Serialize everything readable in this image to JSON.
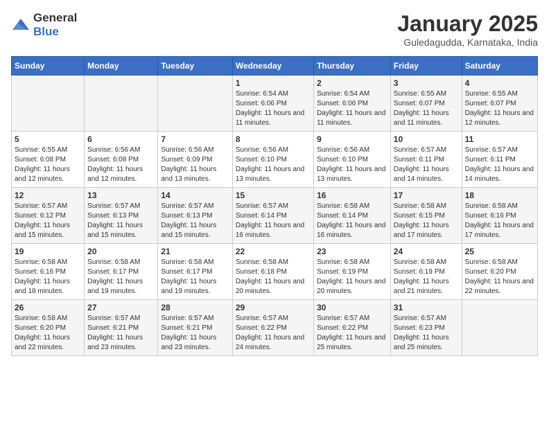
{
  "logo": {
    "general": "General",
    "blue": "Blue"
  },
  "header": {
    "title": "January 2025",
    "subtitle": "Guledagudda, Karnataka, India"
  },
  "weekdays": [
    "Sunday",
    "Monday",
    "Tuesday",
    "Wednesday",
    "Thursday",
    "Friday",
    "Saturday"
  ],
  "weeks": [
    [
      {
        "day": "",
        "info": ""
      },
      {
        "day": "",
        "info": ""
      },
      {
        "day": "",
        "info": ""
      },
      {
        "day": "1",
        "info": "Sunrise: 6:54 AM\nSunset: 6:06 PM\nDaylight: 11 hours and 11 minutes."
      },
      {
        "day": "2",
        "info": "Sunrise: 6:54 AM\nSunset: 6:06 PM\nDaylight: 11 hours and 11 minutes."
      },
      {
        "day": "3",
        "info": "Sunrise: 6:55 AM\nSunset: 6:07 PM\nDaylight: 11 hours and 11 minutes."
      },
      {
        "day": "4",
        "info": "Sunrise: 6:55 AM\nSunset: 6:07 PM\nDaylight: 11 hours and 12 minutes."
      }
    ],
    [
      {
        "day": "5",
        "info": "Sunrise: 6:55 AM\nSunset: 6:08 PM\nDaylight: 11 hours and 12 minutes."
      },
      {
        "day": "6",
        "info": "Sunrise: 6:56 AM\nSunset: 6:08 PM\nDaylight: 11 hours and 12 minutes."
      },
      {
        "day": "7",
        "info": "Sunrise: 6:56 AM\nSunset: 6:09 PM\nDaylight: 11 hours and 13 minutes."
      },
      {
        "day": "8",
        "info": "Sunrise: 6:56 AM\nSunset: 6:10 PM\nDaylight: 11 hours and 13 minutes."
      },
      {
        "day": "9",
        "info": "Sunrise: 6:56 AM\nSunset: 6:10 PM\nDaylight: 11 hours and 13 minutes."
      },
      {
        "day": "10",
        "info": "Sunrise: 6:57 AM\nSunset: 6:11 PM\nDaylight: 11 hours and 14 minutes."
      },
      {
        "day": "11",
        "info": "Sunrise: 6:57 AM\nSunset: 6:11 PM\nDaylight: 11 hours and 14 minutes."
      }
    ],
    [
      {
        "day": "12",
        "info": "Sunrise: 6:57 AM\nSunset: 6:12 PM\nDaylight: 11 hours and 15 minutes."
      },
      {
        "day": "13",
        "info": "Sunrise: 6:57 AM\nSunset: 6:13 PM\nDaylight: 11 hours and 15 minutes."
      },
      {
        "day": "14",
        "info": "Sunrise: 6:57 AM\nSunset: 6:13 PM\nDaylight: 11 hours and 15 minutes."
      },
      {
        "day": "15",
        "info": "Sunrise: 6:57 AM\nSunset: 6:14 PM\nDaylight: 11 hours and 16 minutes."
      },
      {
        "day": "16",
        "info": "Sunrise: 6:58 AM\nSunset: 6:14 PM\nDaylight: 11 hours and 16 minutes."
      },
      {
        "day": "17",
        "info": "Sunrise: 6:58 AM\nSunset: 6:15 PM\nDaylight: 11 hours and 17 minutes."
      },
      {
        "day": "18",
        "info": "Sunrise: 6:58 AM\nSunset: 6:16 PM\nDaylight: 11 hours and 17 minutes."
      }
    ],
    [
      {
        "day": "19",
        "info": "Sunrise: 6:58 AM\nSunset: 6:16 PM\nDaylight: 11 hours and 18 minutes."
      },
      {
        "day": "20",
        "info": "Sunrise: 6:58 AM\nSunset: 6:17 PM\nDaylight: 11 hours and 19 minutes."
      },
      {
        "day": "21",
        "info": "Sunrise: 6:58 AM\nSunset: 6:17 PM\nDaylight: 11 hours and 19 minutes."
      },
      {
        "day": "22",
        "info": "Sunrise: 6:58 AM\nSunset: 6:18 PM\nDaylight: 11 hours and 20 minutes."
      },
      {
        "day": "23",
        "info": "Sunrise: 6:58 AM\nSunset: 6:19 PM\nDaylight: 11 hours and 20 minutes."
      },
      {
        "day": "24",
        "info": "Sunrise: 6:58 AM\nSunset: 6:19 PM\nDaylight: 11 hours and 21 minutes."
      },
      {
        "day": "25",
        "info": "Sunrise: 6:58 AM\nSunset: 6:20 PM\nDaylight: 11 hours and 22 minutes."
      }
    ],
    [
      {
        "day": "26",
        "info": "Sunrise: 6:58 AM\nSunset: 6:20 PM\nDaylight: 11 hours and 22 minutes."
      },
      {
        "day": "27",
        "info": "Sunrise: 6:57 AM\nSunset: 6:21 PM\nDaylight: 11 hours and 23 minutes."
      },
      {
        "day": "28",
        "info": "Sunrise: 6:57 AM\nSunset: 6:21 PM\nDaylight: 11 hours and 23 minutes."
      },
      {
        "day": "29",
        "info": "Sunrise: 6:57 AM\nSunset: 6:22 PM\nDaylight: 11 hours and 24 minutes."
      },
      {
        "day": "30",
        "info": "Sunrise: 6:57 AM\nSunset: 6:22 PM\nDaylight: 11 hours and 25 minutes."
      },
      {
        "day": "31",
        "info": "Sunrise: 6:57 AM\nSunset: 6:23 PM\nDaylight: 11 hours and 25 minutes."
      },
      {
        "day": "",
        "info": ""
      }
    ]
  ]
}
